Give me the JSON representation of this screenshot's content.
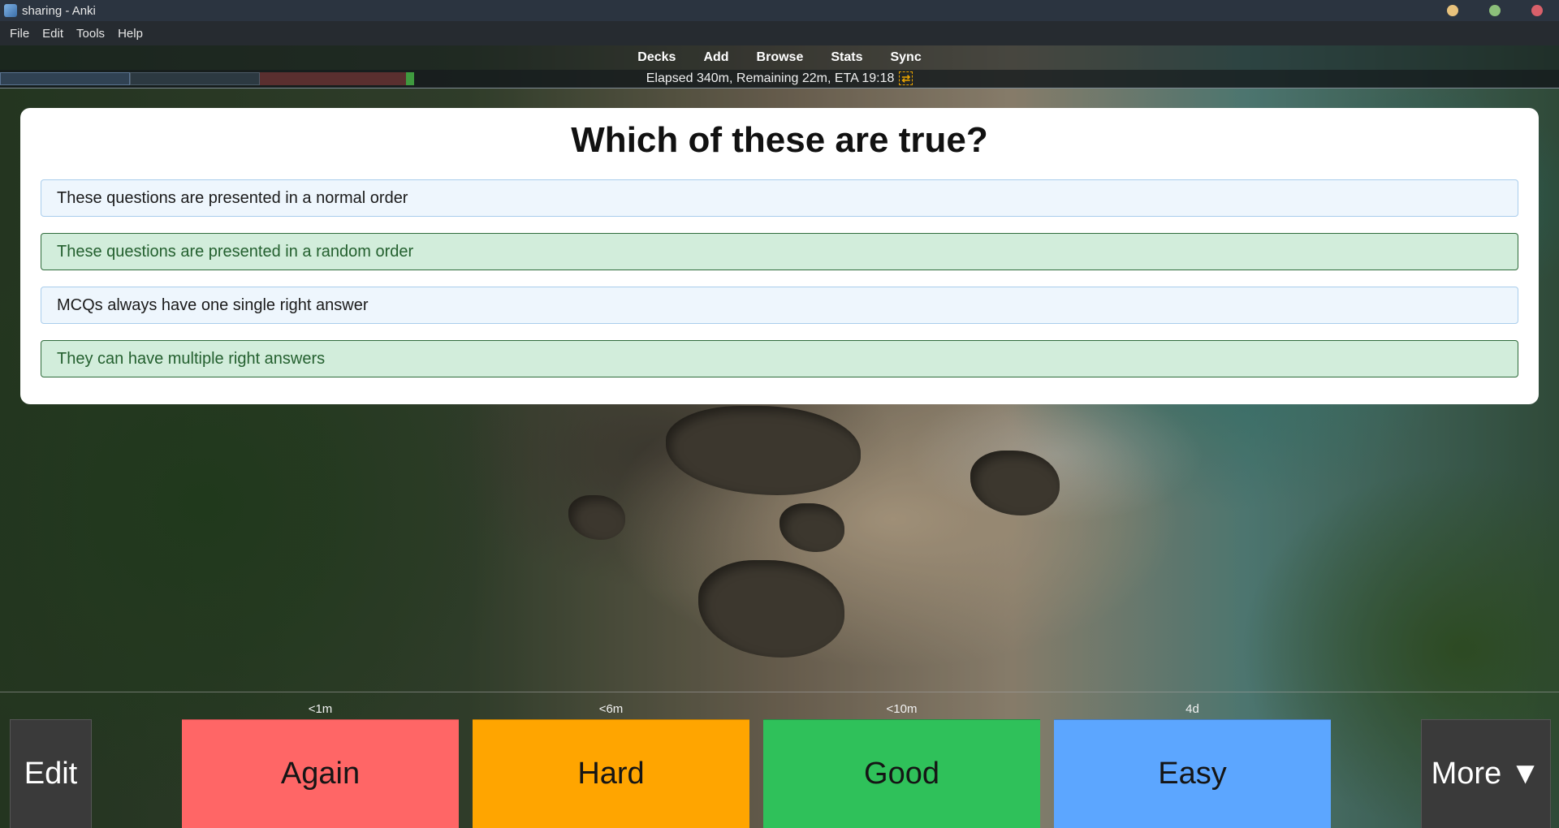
{
  "window": {
    "title": "sharing - Anki",
    "app_icon": "anki-icon",
    "controls": {
      "minimize_color": "#e8c27c",
      "maximize_color": "#8cbf7a",
      "close_color": "#d9606a"
    }
  },
  "menubar": {
    "items": [
      "File",
      "Edit",
      "Tools",
      "Help"
    ]
  },
  "toolbar": {
    "items": [
      "Decks",
      "Add",
      "Browse",
      "Stats",
      "Sync"
    ]
  },
  "status": {
    "text": "Elapsed 340m, Remaining 22m, ETA 19:18",
    "refresh_icon": "refresh-icon",
    "refresh_glyph": "⇄"
  },
  "card": {
    "question": "Which of these are true?",
    "options": [
      {
        "text": "These questions are presented in a normal order",
        "state": "neutral"
      },
      {
        "text": "These questions are presented in a random order",
        "state": "correct"
      },
      {
        "text": "MCQs always have one single right answer",
        "state": "neutral"
      },
      {
        "text": "They can have multiple right answers",
        "state": "correct"
      }
    ]
  },
  "answer_bar": {
    "edit_label": "Edit",
    "more_label": "More ▼",
    "buttons": [
      {
        "label": "Again",
        "interval": "<1m",
        "color": "#ff6666"
      },
      {
        "label": "Hard",
        "interval": "<6m",
        "color": "#ffa500"
      },
      {
        "label": "Good",
        "interval": "<10m",
        "color": "#2fc15a"
      },
      {
        "label": "Easy",
        "interval": "4d",
        "color": "#5ca6ff"
      }
    ]
  }
}
